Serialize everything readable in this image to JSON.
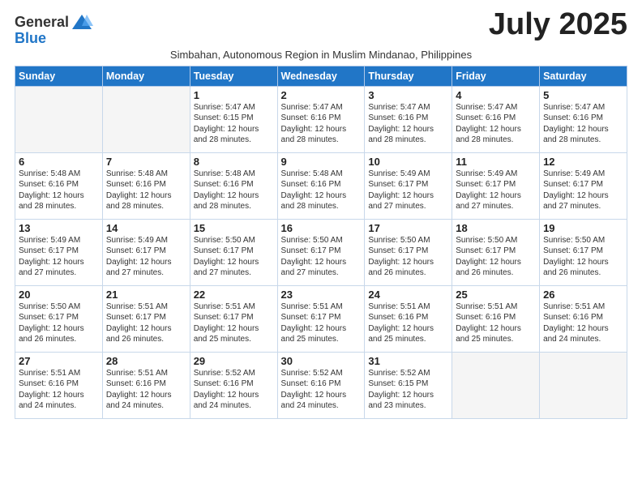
{
  "logo": {
    "general": "General",
    "blue": "Blue"
  },
  "title": "July 2025",
  "subtitle": "Simbahan, Autonomous Region in Muslim Mindanao, Philippines",
  "days_of_week": [
    "Sunday",
    "Monday",
    "Tuesday",
    "Wednesday",
    "Thursday",
    "Friday",
    "Saturday"
  ],
  "weeks": [
    [
      {
        "day": "",
        "info": ""
      },
      {
        "day": "",
        "info": ""
      },
      {
        "day": "1",
        "info": "Sunrise: 5:47 AM\nSunset: 6:15 PM\nDaylight: 12 hours and 28 minutes."
      },
      {
        "day": "2",
        "info": "Sunrise: 5:47 AM\nSunset: 6:16 PM\nDaylight: 12 hours and 28 minutes."
      },
      {
        "day": "3",
        "info": "Sunrise: 5:47 AM\nSunset: 6:16 PM\nDaylight: 12 hours and 28 minutes."
      },
      {
        "day": "4",
        "info": "Sunrise: 5:47 AM\nSunset: 6:16 PM\nDaylight: 12 hours and 28 minutes."
      },
      {
        "day": "5",
        "info": "Sunrise: 5:47 AM\nSunset: 6:16 PM\nDaylight: 12 hours and 28 minutes."
      }
    ],
    [
      {
        "day": "6",
        "info": "Sunrise: 5:48 AM\nSunset: 6:16 PM\nDaylight: 12 hours and 28 minutes."
      },
      {
        "day": "7",
        "info": "Sunrise: 5:48 AM\nSunset: 6:16 PM\nDaylight: 12 hours and 28 minutes."
      },
      {
        "day": "8",
        "info": "Sunrise: 5:48 AM\nSunset: 6:16 PM\nDaylight: 12 hours and 28 minutes."
      },
      {
        "day": "9",
        "info": "Sunrise: 5:48 AM\nSunset: 6:16 PM\nDaylight: 12 hours and 28 minutes."
      },
      {
        "day": "10",
        "info": "Sunrise: 5:49 AM\nSunset: 6:17 PM\nDaylight: 12 hours and 27 minutes."
      },
      {
        "day": "11",
        "info": "Sunrise: 5:49 AM\nSunset: 6:17 PM\nDaylight: 12 hours and 27 minutes."
      },
      {
        "day": "12",
        "info": "Sunrise: 5:49 AM\nSunset: 6:17 PM\nDaylight: 12 hours and 27 minutes."
      }
    ],
    [
      {
        "day": "13",
        "info": "Sunrise: 5:49 AM\nSunset: 6:17 PM\nDaylight: 12 hours and 27 minutes."
      },
      {
        "day": "14",
        "info": "Sunrise: 5:49 AM\nSunset: 6:17 PM\nDaylight: 12 hours and 27 minutes."
      },
      {
        "day": "15",
        "info": "Sunrise: 5:50 AM\nSunset: 6:17 PM\nDaylight: 12 hours and 27 minutes."
      },
      {
        "day": "16",
        "info": "Sunrise: 5:50 AM\nSunset: 6:17 PM\nDaylight: 12 hours and 27 minutes."
      },
      {
        "day": "17",
        "info": "Sunrise: 5:50 AM\nSunset: 6:17 PM\nDaylight: 12 hours and 26 minutes."
      },
      {
        "day": "18",
        "info": "Sunrise: 5:50 AM\nSunset: 6:17 PM\nDaylight: 12 hours and 26 minutes."
      },
      {
        "day": "19",
        "info": "Sunrise: 5:50 AM\nSunset: 6:17 PM\nDaylight: 12 hours and 26 minutes."
      }
    ],
    [
      {
        "day": "20",
        "info": "Sunrise: 5:50 AM\nSunset: 6:17 PM\nDaylight: 12 hours and 26 minutes."
      },
      {
        "day": "21",
        "info": "Sunrise: 5:51 AM\nSunset: 6:17 PM\nDaylight: 12 hours and 26 minutes."
      },
      {
        "day": "22",
        "info": "Sunrise: 5:51 AM\nSunset: 6:17 PM\nDaylight: 12 hours and 25 minutes."
      },
      {
        "day": "23",
        "info": "Sunrise: 5:51 AM\nSunset: 6:17 PM\nDaylight: 12 hours and 25 minutes."
      },
      {
        "day": "24",
        "info": "Sunrise: 5:51 AM\nSunset: 6:16 PM\nDaylight: 12 hours and 25 minutes."
      },
      {
        "day": "25",
        "info": "Sunrise: 5:51 AM\nSunset: 6:16 PM\nDaylight: 12 hours and 25 minutes."
      },
      {
        "day": "26",
        "info": "Sunrise: 5:51 AM\nSunset: 6:16 PM\nDaylight: 12 hours and 24 minutes."
      }
    ],
    [
      {
        "day": "27",
        "info": "Sunrise: 5:51 AM\nSunset: 6:16 PM\nDaylight: 12 hours and 24 minutes."
      },
      {
        "day": "28",
        "info": "Sunrise: 5:51 AM\nSunset: 6:16 PM\nDaylight: 12 hours and 24 minutes."
      },
      {
        "day": "29",
        "info": "Sunrise: 5:52 AM\nSunset: 6:16 PM\nDaylight: 12 hours and 24 minutes."
      },
      {
        "day": "30",
        "info": "Sunrise: 5:52 AM\nSunset: 6:16 PM\nDaylight: 12 hours and 24 minutes."
      },
      {
        "day": "31",
        "info": "Sunrise: 5:52 AM\nSunset: 6:15 PM\nDaylight: 12 hours and 23 minutes."
      },
      {
        "day": "",
        "info": ""
      },
      {
        "day": "",
        "info": ""
      }
    ]
  ]
}
